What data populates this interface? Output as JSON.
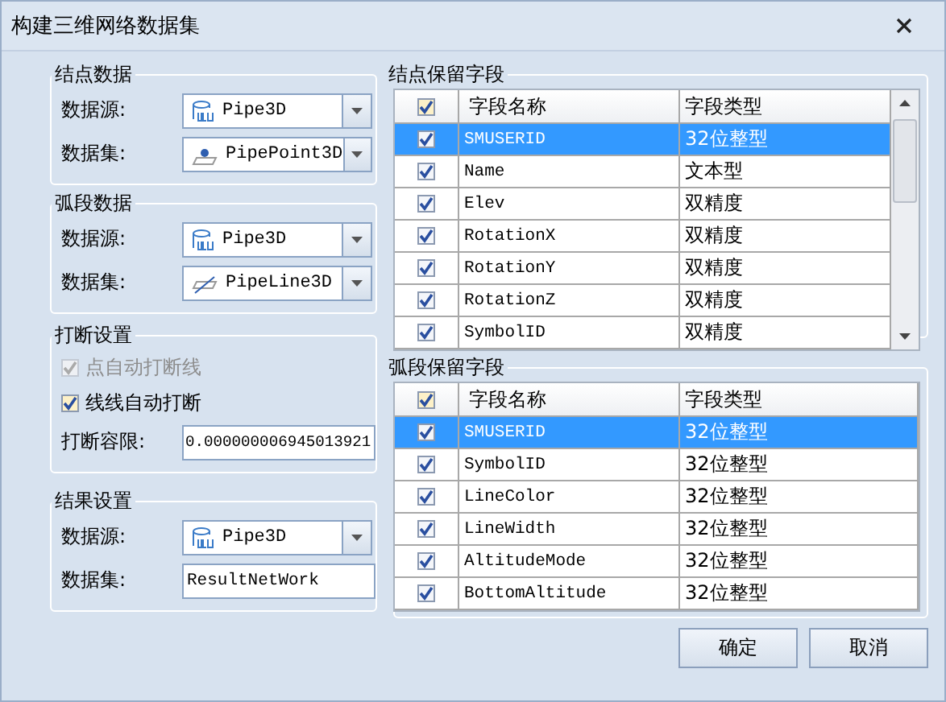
{
  "window": {
    "title": "构建三维网络数据集"
  },
  "node_data": {
    "title": "结点数据",
    "datasource": {
      "label": "数据源:",
      "value": "Pipe3D"
    },
    "dataset": {
      "label": "数据集:",
      "value": "PipePoint3D"
    }
  },
  "arc_data": {
    "title": "弧段数据",
    "datasource": {
      "label": "数据源:",
      "value": "Pipe3D"
    },
    "dataset": {
      "label": "数据集:",
      "value": "PipeLine3D"
    }
  },
  "break_settings": {
    "title": "打断设置",
    "options": [
      {
        "label": "点自动打断线",
        "checked": true,
        "disabled": true
      },
      {
        "label": "线线自动打断",
        "checked": true,
        "disabled": false
      }
    ],
    "tolerance": {
      "label": "打断容限:",
      "value": "0.000000006945013921"
    }
  },
  "result_settings": {
    "title": "结果设置",
    "datasource": {
      "label": "数据源:",
      "value": "Pipe3D"
    },
    "dataset": {
      "label": "数据集:",
      "value": "ResultNetWork"
    }
  },
  "node_fields": {
    "title": "结点保留字段",
    "header_checked": true,
    "columns": [
      "字段名称",
      "字段类型"
    ],
    "rows": [
      {
        "name": "SMUSERID",
        "type": "32位整型",
        "checked": true,
        "selected": true
      },
      {
        "name": "Name",
        "type": "文本型",
        "checked": true,
        "selected": false
      },
      {
        "name": "Elev",
        "type": "双精度",
        "checked": true,
        "selected": false
      },
      {
        "name": "RotationX",
        "type": "双精度",
        "checked": true,
        "selected": false
      },
      {
        "name": "RotationY",
        "type": "双精度",
        "checked": true,
        "selected": false
      },
      {
        "name": "RotationZ",
        "type": "双精度",
        "checked": true,
        "selected": false
      },
      {
        "name": "SymbolID",
        "type": "双精度",
        "checked": true,
        "selected": false
      }
    ]
  },
  "arc_fields": {
    "title": "弧段保留字段",
    "header_checked": true,
    "columns": [
      "字段名称",
      "字段类型"
    ],
    "rows": [
      {
        "name": "SMUSERID",
        "type": "32位整型",
        "checked": true,
        "selected": true
      },
      {
        "name": "SymbolID",
        "type": "32位整型",
        "checked": true,
        "selected": false
      },
      {
        "name": "LineColor",
        "type": "32位整型",
        "checked": true,
        "selected": false
      },
      {
        "name": "LineWidth",
        "type": "32位整型",
        "checked": true,
        "selected": false
      },
      {
        "name": "AltitudeMode",
        "type": "32位整型",
        "checked": true,
        "selected": false
      },
      {
        "name": "BottomAltitude",
        "type": "32位整型",
        "checked": true,
        "selected": false
      }
    ]
  },
  "buttons": [
    "确定",
    "取消"
  ]
}
